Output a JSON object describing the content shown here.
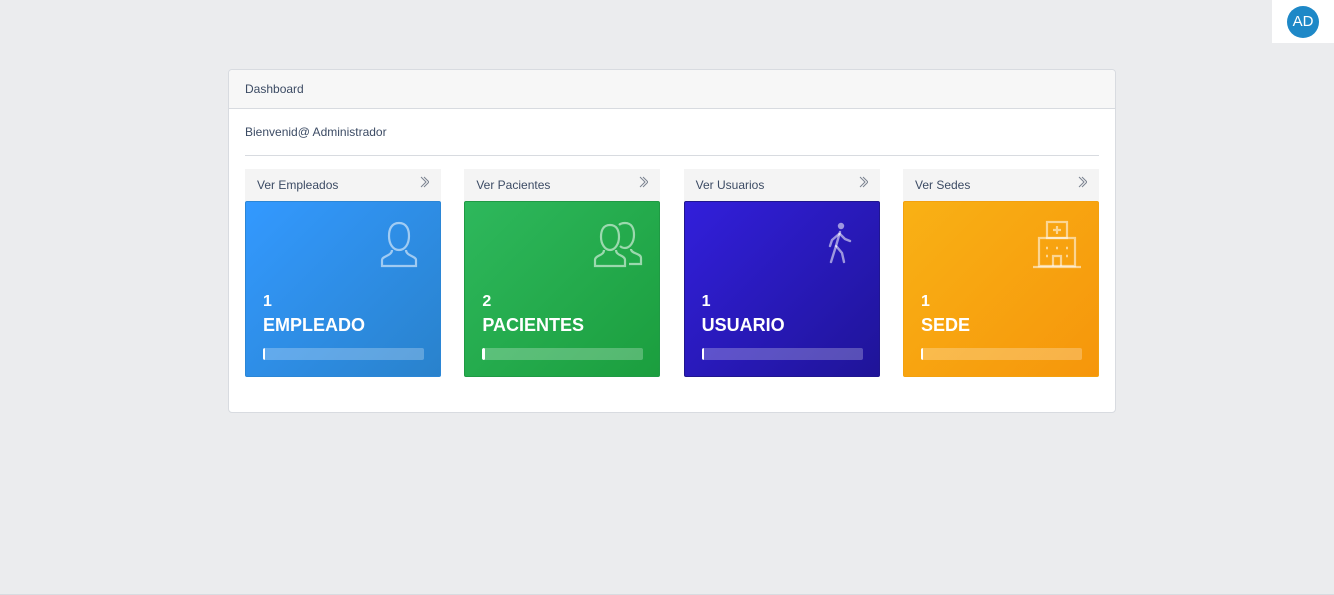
{
  "header": {
    "avatar_initials": "AD"
  },
  "card": {
    "title": "Dashboard",
    "welcome": "Bienvenid@ Administrador"
  },
  "tiles": [
    {
      "link_label": "Ver Empleados",
      "count": "1",
      "label": "EMPLEADO",
      "icon": "user-icon",
      "color": "#3399ff",
      "progress": 0.01
    },
    {
      "link_label": "Ver Pacientes",
      "count": "2",
      "label": "PACIENTES",
      "icon": "users-icon",
      "color": "#2eb85c",
      "progress": 0.01
    },
    {
      "link_label": "Ver Usuarios",
      "count": "1",
      "label": "USUARIO",
      "icon": "walking-person-icon",
      "color": "#321fdb",
      "progress": 0.01
    },
    {
      "link_label": "Ver Sedes",
      "count": "1",
      "label": "SEDE",
      "icon": "hospital-icon",
      "color": "#f9b115",
      "progress": 0.01
    }
  ]
}
